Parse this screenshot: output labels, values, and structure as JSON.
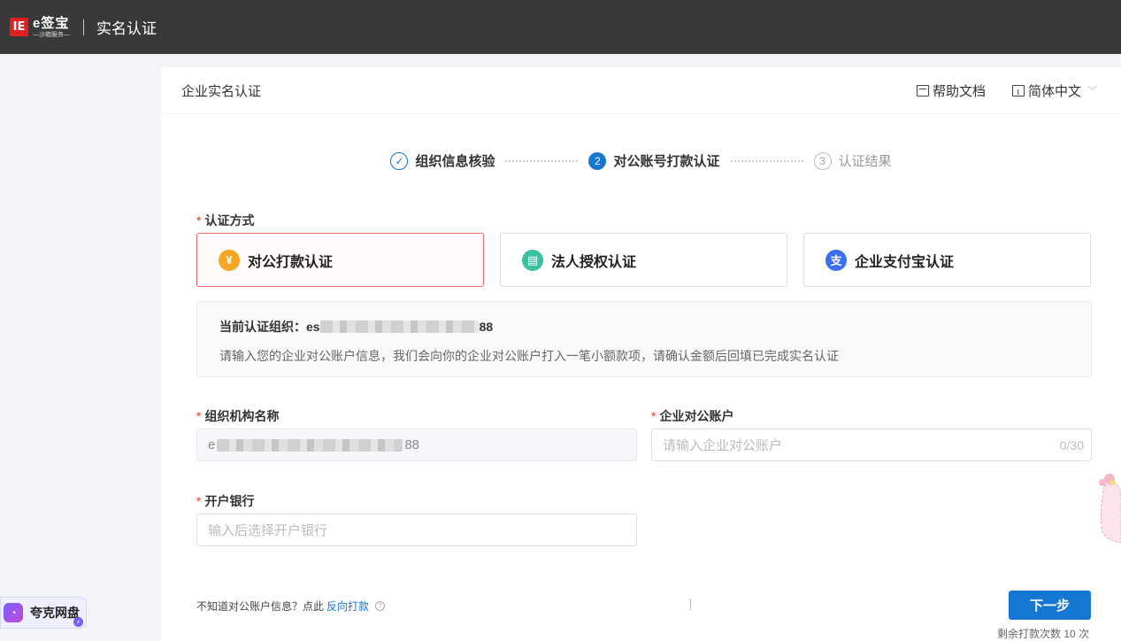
{
  "topbar": {
    "logo_mark": "IE",
    "logo_name": "e签宝",
    "logo_sub": "—沙箱服务—",
    "title": "实名认证"
  },
  "card": {
    "title": "企业实名认证",
    "help_label": "帮助文档",
    "lang_label": "简体中文"
  },
  "steps": [
    {
      "num": "✓",
      "label": "组织信息核验",
      "state": "done"
    },
    {
      "num": "2",
      "label": "对公账号打款认证",
      "state": "active"
    },
    {
      "num": "3",
      "label": "认证结果",
      "state": "wait"
    }
  ],
  "method_section": {
    "required_mark": "*",
    "label": "认证方式",
    "options": [
      {
        "label": "对公打款认证",
        "icon": "yen-icon",
        "glyph": "¥",
        "color": "#f5a623",
        "selected": true
      },
      {
        "label": "法人授权认证",
        "icon": "document-icon",
        "glyph": "▤",
        "color": "#3cc1a0",
        "selected": false
      },
      {
        "label": "企业支付宝认证",
        "icon": "alipay-icon",
        "glyph": "支",
        "color": "#3b6ef0",
        "selected": false
      }
    ]
  },
  "info": {
    "org_label": "当前认证组织：",
    "org_prefix": "es",
    "org_suffix": "88",
    "desc": "请输入您的企业对公账户信息，我们会向你的企业对公账户打入一笔小额款项，请确认金额后回填已完成实名认证"
  },
  "form": {
    "org_name": {
      "label": "组织机构名称",
      "value_prefix": "e",
      "value_suffix": "88"
    },
    "account": {
      "label": "企业对公账户",
      "placeholder": "请输入企业对公账户",
      "counter": "0/30"
    },
    "bank": {
      "label": "开户银行",
      "placeholder": "输入后选择开户银行"
    }
  },
  "footer": {
    "hint": "不知道对公账户信息？点此",
    "link": "反向打款",
    "next_label": "下一步",
    "remain": "剩余打款次数 10 次"
  },
  "quark": {
    "label": "夸克网盘"
  },
  "colors": {
    "primary": "#1677d2",
    "selected_border": "#e56a6a",
    "topbar": "#393939"
  }
}
